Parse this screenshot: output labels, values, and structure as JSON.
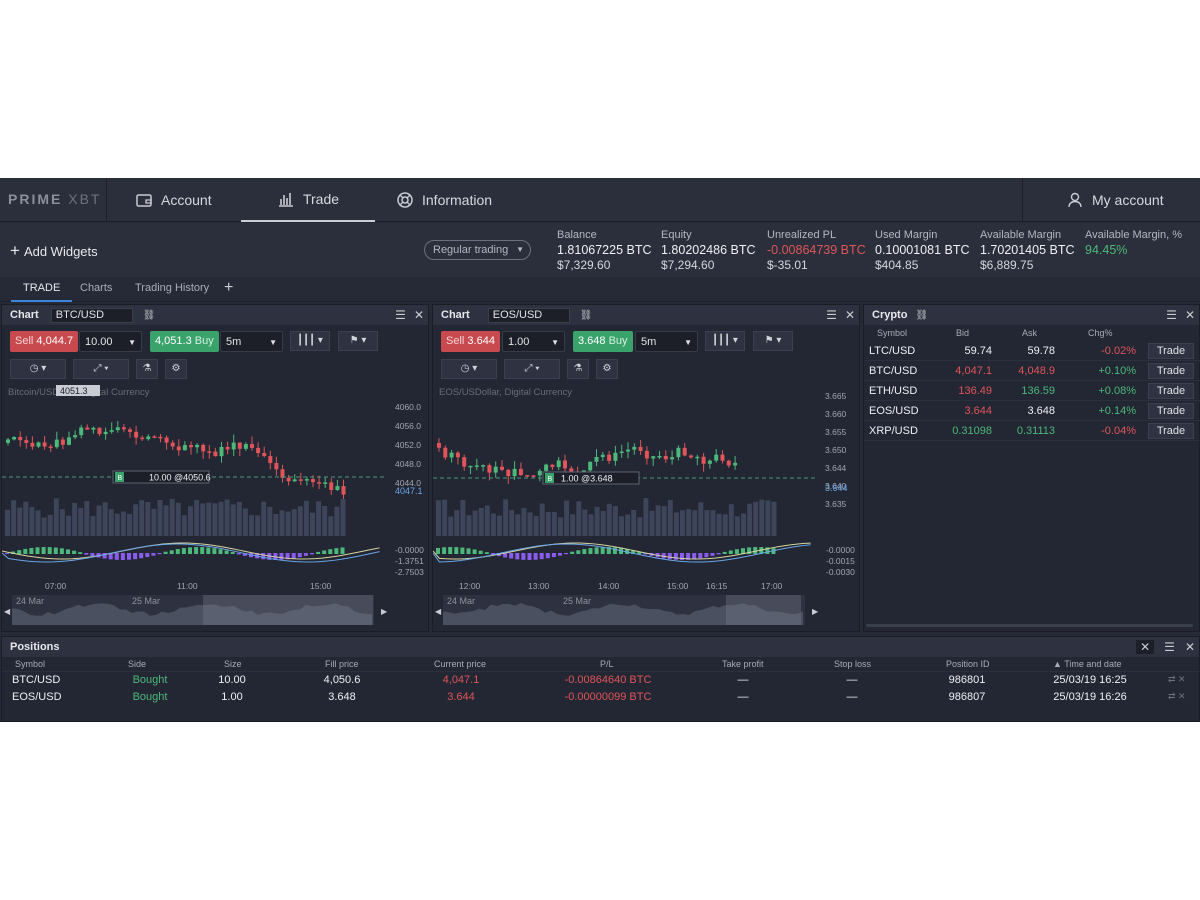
{
  "nav": {
    "logo_bold": "PRIME",
    "logo_light": "XBT",
    "items": [
      {
        "label": "Account",
        "icon": "wallet-icon"
      },
      {
        "label": "Trade",
        "icon": "bar-chart-icon"
      },
      {
        "label": "Information",
        "icon": "lifebuoy-icon"
      }
    ],
    "my_account": "My account"
  },
  "toolbar": {
    "add_widgets": "Add Widgets",
    "mode": "Regular trading",
    "stats": [
      {
        "label": "Balance",
        "v1": "1.81067225 BTC",
        "v2": "$7,329.60"
      },
      {
        "label": "Equity",
        "v1": "1.80202486 BTC",
        "v2": "$7,294.60"
      },
      {
        "label": "Unrealized PL",
        "v1": "-0.00864739 BTC",
        "v2": "$-35.01"
      },
      {
        "label": "Used Margin",
        "v1": "0.10001081 BTC",
        "v2": "$404.85"
      },
      {
        "label": "Available Margin",
        "v1": "1.70201405 BTC",
        "v2": "$6,889.75"
      },
      {
        "label": "Available Margin, %",
        "v1": "94.45%",
        "v2": ""
      }
    ]
  },
  "tabs": [
    "TRADE",
    "Charts",
    "Trading History"
  ],
  "charts": [
    {
      "title": "Chart",
      "symbol": "BTC/USD",
      "sell_label": "Sell",
      "sell_price": "4,044.7",
      "qty": "10.00",
      "buy_price": "4,051.3",
      "buy_label": "Buy",
      "interval": "5m",
      "series_label": "Bitcoin/USDollar, Digital Currency",
      "hover_label": "4051.3",
      "order_line": "10.00 @4050.6",
      "order_badge": "B",
      "price_ticks": [
        "4060.0",
        "4056.0",
        "4052.0",
        "4048.0",
        "4044.0"
      ],
      "current_price": "4047.1",
      "macd_ticks": [
        "-0.0000",
        "-1.3751",
        "-2.7503"
      ],
      "time_ticks": [
        "07:00",
        "11:00",
        "15:00"
      ],
      "nav_dates": [
        "24 Mar",
        "25 Mar"
      ]
    },
    {
      "title": "Chart",
      "symbol": "EOS/USD",
      "sell_label": "Sell",
      "sell_price": "3.644",
      "qty": "1.00",
      "buy_price": "3.648",
      "buy_label": "Buy",
      "interval": "5m",
      "series_label": "EOS/USDollar, Digital Currency",
      "hover_label": "",
      "order_line": "1.00 @3.648",
      "order_badge": "B",
      "price_ticks": [
        "3.665",
        "3.660",
        "3.655",
        "3.650",
        "3.644",
        "3.640",
        "3.635"
      ],
      "current_price": "3.644",
      "macd_ticks": [
        "-0.0000",
        "-0.0015",
        "-0.0030"
      ],
      "time_ticks": [
        "12:00",
        "13:00",
        "14:00",
        "15:00",
        "16:15",
        "17:00"
      ],
      "nav_dates": [
        "24 Mar",
        "25 Mar"
      ]
    }
  ],
  "crypto": {
    "title": "Crypto",
    "headers": [
      "Symbol",
      "Bid",
      "Ask",
      "Chg%"
    ],
    "trade_label": "Trade",
    "rows": [
      {
        "symbol": "LTC/USD",
        "bid": "59.74",
        "ask": "59.78",
        "chg": "-0.02%",
        "bid_color": "white",
        "ask_color": "white",
        "chg_color": "red"
      },
      {
        "symbol": "BTC/USD",
        "bid": "4,047.1",
        "ask": "4,048.9",
        "chg": "+0.10%",
        "bid_color": "red",
        "ask_color": "red",
        "chg_color": "green"
      },
      {
        "symbol": "ETH/USD",
        "bid": "136.49",
        "ask": "136.59",
        "chg": "+0.08%",
        "bid_color": "red",
        "ask_color": "green",
        "chg_color": "green"
      },
      {
        "symbol": "EOS/USD",
        "bid": "3.644",
        "ask": "3.648",
        "chg": "+0.14%",
        "bid_color": "red",
        "ask_color": "white",
        "chg_color": "green"
      },
      {
        "symbol": "XRP/USD",
        "bid": "0.31098",
        "ask": "0.31113",
        "chg": "-0.04%",
        "bid_color": "green",
        "ask_color": "green",
        "chg_color": "red"
      }
    ]
  },
  "positions": {
    "title": "Positions",
    "headers": [
      "Symbol",
      "Side",
      "Size",
      "Fill price",
      "Current price",
      "P/L",
      "Take profit",
      "Stop loss",
      "Position ID",
      "Time and date"
    ],
    "rows": [
      {
        "symbol": "BTC/USD",
        "side": "Bought",
        "size": "10.00",
        "fill": "4,050.6",
        "current": "4,047.1",
        "pl": "-0.00864640 BTC",
        "tp": "—",
        "sl": "—",
        "id": "986801",
        "time": "25/03/19 16:25"
      },
      {
        "symbol": "EOS/USD",
        "side": "Bought",
        "size": "1.00",
        "fill": "3.648",
        "current": "3.644",
        "pl": "-0.00000099 BTC",
        "tp": "—",
        "sl": "—",
        "id": "986807",
        "time": "25/03/19 16:26"
      }
    ]
  },
  "colors": {
    "up": "#4cb87a",
    "down": "#e0545a",
    "accent": "#3b86d9",
    "macd": "#8a5cf0"
  }
}
